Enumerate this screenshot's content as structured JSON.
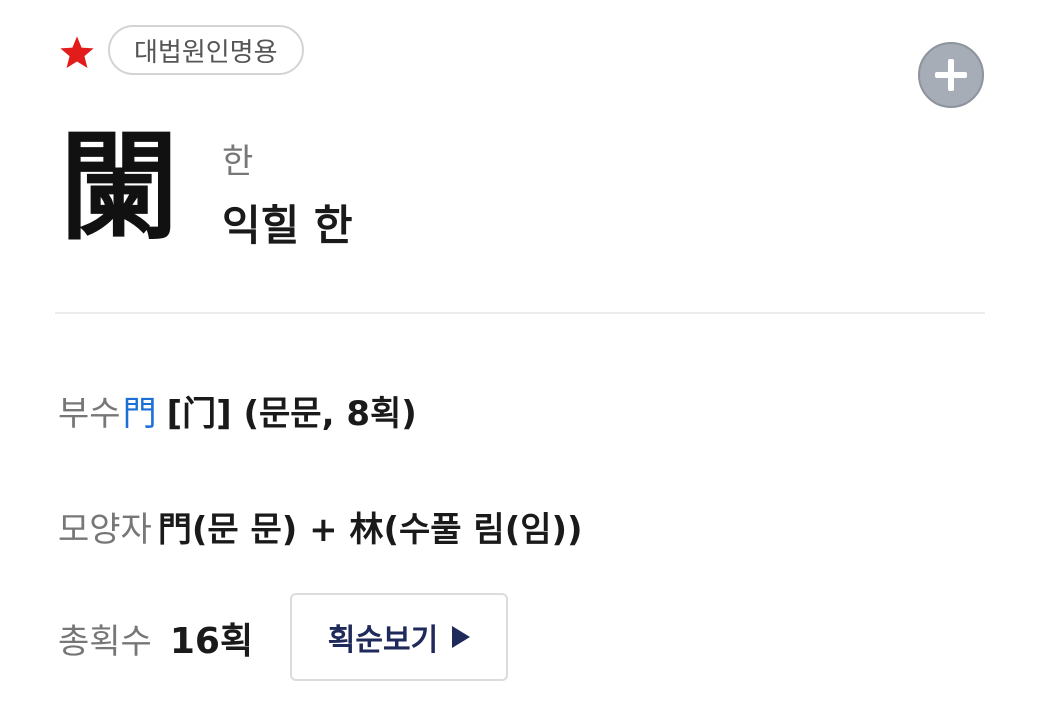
{
  "entry": {
    "badge": "대법원인명용",
    "hanja": "闌",
    "reading": "한",
    "meaning": "익힐 한"
  },
  "details": {
    "radical_label": "부수",
    "radical_char": "門",
    "radical_rest": "[门] (문문, 8획)",
    "shape_label": "모양자",
    "shape_value": "門(문 문) + 林(수풀 림(임))",
    "stroke_label": "총획수",
    "stroke_count": "16획",
    "stroke_button": "획순보기"
  },
  "colors": {
    "star": "#e21b1b",
    "radical_link": "#1b6fd6",
    "button_text": "#1f2a5a",
    "add_button": "#a7adb6"
  },
  "icons": {
    "favorite": "star-icon",
    "add": "plus-icon",
    "play": "triangle-right-icon"
  }
}
